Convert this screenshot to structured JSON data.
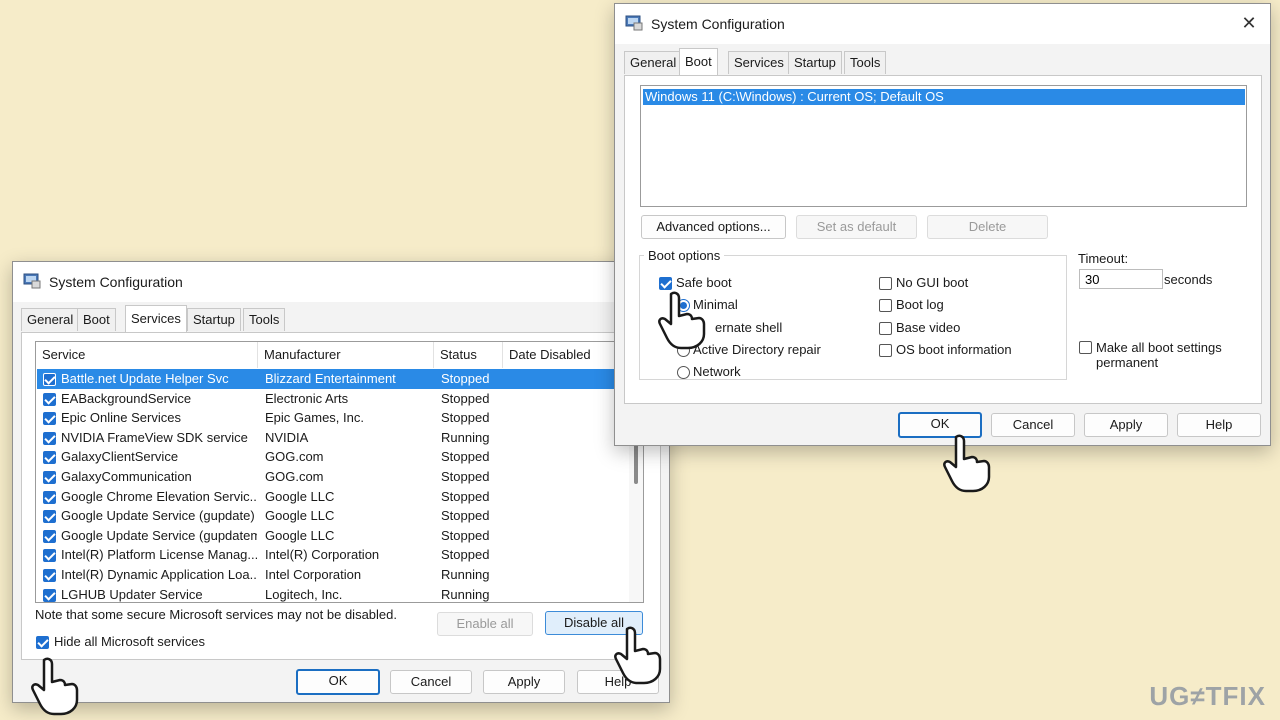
{
  "services_window": {
    "title": "System Configuration",
    "tabs": [
      "General",
      "Boot",
      "Services",
      "Startup",
      "Tools"
    ],
    "active_tab": "Services",
    "columns": [
      "Service",
      "Manufacturer",
      "Status",
      "Date Disabled"
    ],
    "rows": [
      {
        "service": "Battle.net Update Helper Svc",
        "manufacturer": "Blizzard Entertainment",
        "status": "Stopped",
        "date": ""
      },
      {
        "service": "EABackgroundService",
        "manufacturer": "Electronic Arts",
        "status": "Stopped",
        "date": ""
      },
      {
        "service": "Epic Online Services",
        "manufacturer": "Epic Games, Inc.",
        "status": "Stopped",
        "date": ""
      },
      {
        "service": "NVIDIA FrameView SDK service",
        "manufacturer": "NVIDIA",
        "status": "Running",
        "date": ""
      },
      {
        "service": "GalaxyClientService",
        "manufacturer": "GOG.com",
        "status": "Stopped",
        "date": ""
      },
      {
        "service": "GalaxyCommunication",
        "manufacturer": "GOG.com",
        "status": "Stopped",
        "date": ""
      },
      {
        "service": "Google Chrome Elevation Servic...",
        "manufacturer": "Google LLC",
        "status": "Stopped",
        "date": ""
      },
      {
        "service": "Google Update Service (gupdate)",
        "manufacturer": "Google LLC",
        "status": "Stopped",
        "date": ""
      },
      {
        "service": "Google Update Service (gupdatem)",
        "manufacturer": "Google LLC",
        "status": "Stopped",
        "date": ""
      },
      {
        "service": "Intel(R) Platform License Manag...",
        "manufacturer": "Intel(R) Corporation",
        "status": "Stopped",
        "date": ""
      },
      {
        "service": "Intel(R) Dynamic Application Loa...",
        "manufacturer": "Intel Corporation",
        "status": "Running",
        "date": ""
      },
      {
        "service": "LGHUB Updater Service",
        "manufacturer": "Logitech, Inc.",
        "status": "Running",
        "date": ""
      }
    ],
    "note": "Note that some secure Microsoft services may not be disabled.",
    "enable_all": "Enable all",
    "disable_all": "Disable all",
    "hide_ms": "Hide all Microsoft services",
    "ok": "OK",
    "cancel": "Cancel",
    "apply": "Apply",
    "help": "Help"
  },
  "boot_window": {
    "title": "System Configuration",
    "close_glyph": "✕",
    "tabs": [
      "General",
      "Boot",
      "Services",
      "Startup",
      "Tools"
    ],
    "active_tab": "Boot",
    "os_entry": "Windows 11 (C:\\Windows) : Current OS; Default OS",
    "advanced_options": "Advanced options...",
    "set_default": "Set as default",
    "delete": "Delete",
    "boot_options_label": "Boot options",
    "safe_boot": "Safe boot",
    "minimal": "Minimal",
    "alternate_shell": "ernate shell",
    "ad_repair": "Active Directory repair",
    "network": "Network",
    "no_gui": "No GUI boot",
    "boot_log": "Boot log",
    "base_video": "Base video",
    "os_boot_info": "OS boot information",
    "timeout_label": "Timeout:",
    "timeout_value": "30",
    "seconds": "seconds",
    "make_permanent_1": "Make all boot settings",
    "make_permanent_2": "permanent",
    "ok": "OK",
    "cancel": "Cancel",
    "apply": "Apply",
    "help": "Help"
  },
  "watermark": "UG≠TFIX"
}
